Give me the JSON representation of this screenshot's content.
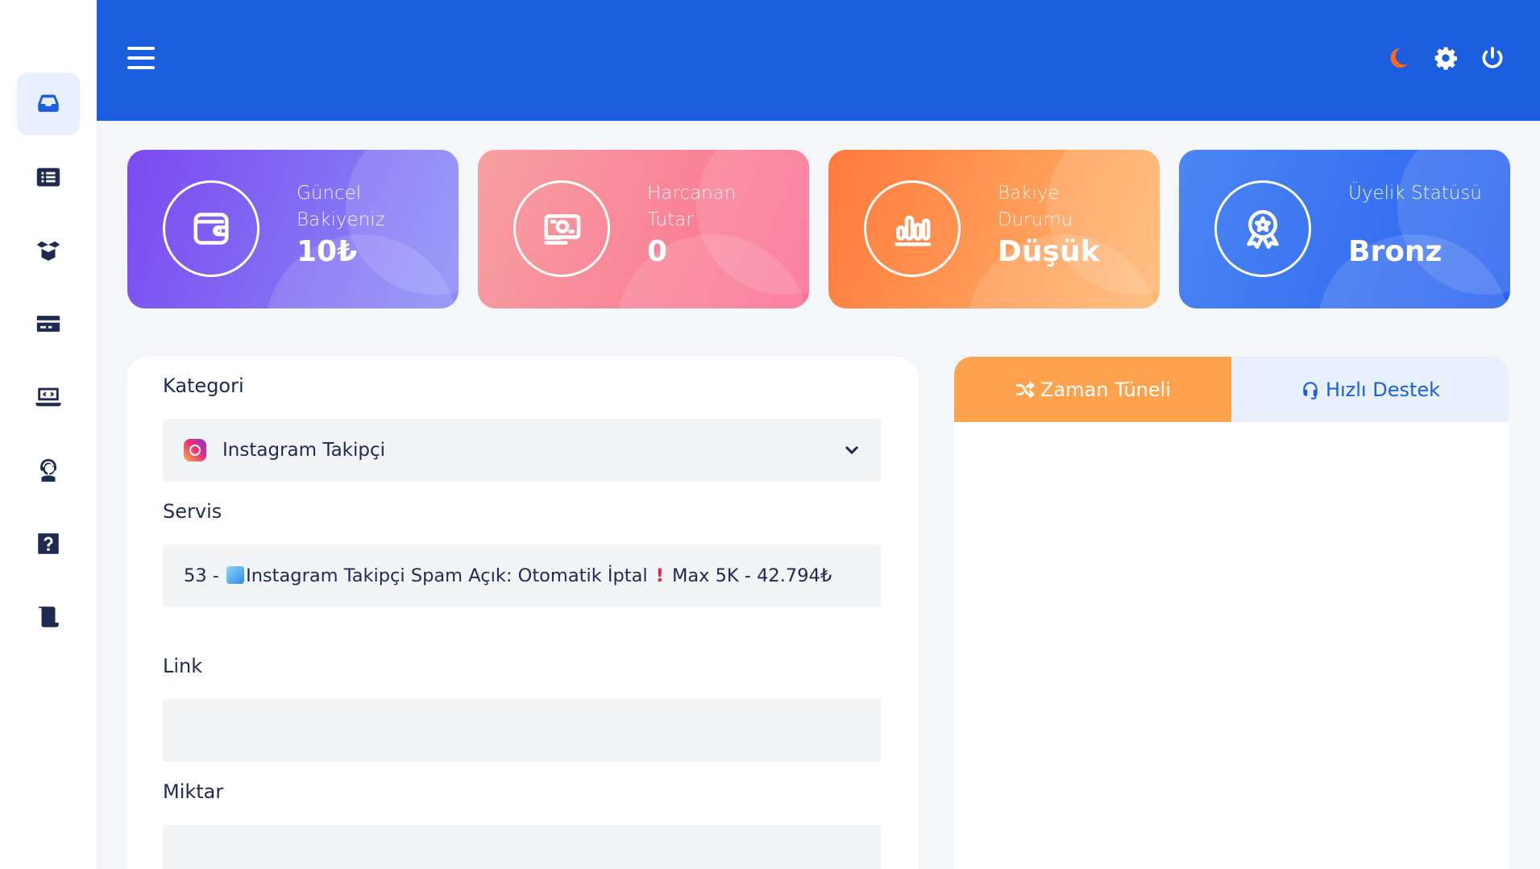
{
  "sidebar": {
    "items": [
      {
        "name": "inbox-icon",
        "active": true
      },
      {
        "name": "list-icon",
        "active": false
      },
      {
        "name": "open-box-icon",
        "active": false
      },
      {
        "name": "credit-card-icon",
        "active": false
      },
      {
        "name": "laptop-code-icon",
        "active": false
      },
      {
        "name": "support-agent-icon",
        "active": false
      },
      {
        "name": "question-icon",
        "active": false
      },
      {
        "name": "scroll-icon",
        "active": false
      }
    ]
  },
  "header": {
    "menu_icon": "hamburger-icon",
    "icons": [
      "moon-icon",
      "gear-icon",
      "power-icon"
    ],
    "colors": {
      "background": "#1b5fe0",
      "moon": "#ff6a1a"
    }
  },
  "stats": [
    {
      "label": "Güncel Bakiyeniz",
      "value": "10₺",
      "icon": "wallet-icon"
    },
    {
      "label": "Harcanan Tutar",
      "value": "0",
      "icon": "money-icon"
    },
    {
      "label": "Bakiye Durumu",
      "value": "Düşük",
      "icon": "chart-icon"
    },
    {
      "label": "Üyelik Statüsü",
      "value": "Bronz",
      "icon": "award-icon"
    }
  ],
  "form": {
    "category_label": "Kategori",
    "category_value": "Instagram Takipçi",
    "service_label": "Servis",
    "service_prefix": "53 - ",
    "service_name": "Instagram Takipçi Spam Açık: Otomatik İptal",
    "service_suffix": "Max 5K - 42.794₺",
    "link_label": "Link",
    "link_value": "",
    "quantity_label": "Miktar",
    "quantity_value": ""
  },
  "tabs": [
    {
      "label": "Zaman Tüneli",
      "icon": "shuffle-icon",
      "active": true
    },
    {
      "label": "Hızlı Destek",
      "icon": "headset-icon",
      "active": false
    }
  ]
}
